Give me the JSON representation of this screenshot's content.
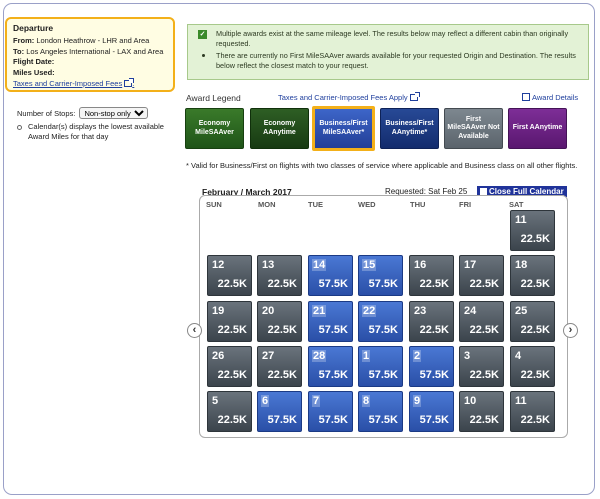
{
  "departure": {
    "title": "Departure",
    "from_label": "From:",
    "from_value": "London Heathrow - LHR and Area",
    "to_label": "To:",
    "to_value": "Los Angeles International - LAX and Area",
    "flight_date_label": "Flight Date:",
    "miles_used_label": "Miles Used:",
    "fees_link": "Taxes and Carrier-Imposed Fees"
  },
  "stops": {
    "label": "Number of Stops:",
    "selected": "Non-stop only",
    "note": "Calendar(s) displays the lowest available Award Miles for that day"
  },
  "info": {
    "line1": "Multiple awards exist at the same mileage level. The results below may reflect a different cabin than originally requested.",
    "line2": "There are currently no First MileSAAver awards available for your requested Origin and Destination. The results below reflect the closest match to your request."
  },
  "legend": {
    "title": "Award Legend",
    "fees_link": "Taxes and Carrier-Imposed Fees Apply",
    "award_details": "Award Details",
    "items": [
      "Economy MileSAAver",
      "Economy AAnytime",
      "Business/First MileSAAver*",
      "Business/First AAnytime*",
      "First MileSAAver Not Available",
      "First AAnytime"
    ]
  },
  "valid_note": "* Valid for Business/First on flights with two classes of service where applicable and Business class on all other flights.",
  "calendar": {
    "month": "February / March 2017",
    "requested": "Requested: Sat Feb 25",
    "close": "Close Full Calendar",
    "days": [
      "SUN",
      "MON",
      "TUE",
      "WED",
      "THU",
      "FRI",
      "SAT"
    ],
    "weeks": [
      [
        null,
        null,
        null,
        null,
        null,
        null,
        {
          "d": "11",
          "v": "22.5K",
          "t": "econ"
        }
      ],
      [
        {
          "d": "12",
          "v": "22.5K",
          "t": "econ"
        },
        {
          "d": "13",
          "v": "22.5K",
          "t": "econ"
        },
        {
          "d": "14",
          "v": "57.5K",
          "t": "bus"
        },
        {
          "d": "15",
          "v": "57.5K",
          "t": "bus"
        },
        {
          "d": "16",
          "v": "22.5K",
          "t": "econ"
        },
        {
          "d": "17",
          "v": "22.5K",
          "t": "econ"
        },
        {
          "d": "18",
          "v": "22.5K",
          "t": "econ"
        }
      ],
      [
        {
          "d": "19",
          "v": "22.5K",
          "t": "econ"
        },
        {
          "d": "20",
          "v": "22.5K",
          "t": "econ"
        },
        {
          "d": "21",
          "v": "57.5K",
          "t": "bus"
        },
        {
          "d": "22",
          "v": "57.5K",
          "t": "bus"
        },
        {
          "d": "23",
          "v": "22.5K",
          "t": "econ"
        },
        {
          "d": "24",
          "v": "22.5K",
          "t": "econ"
        },
        {
          "d": "25",
          "v": "22.5K",
          "t": "econ"
        }
      ],
      [
        {
          "d": "26",
          "v": "22.5K",
          "t": "econ"
        },
        {
          "d": "27",
          "v": "22.5K",
          "t": "econ"
        },
        {
          "d": "28",
          "v": "57.5K",
          "t": "bus"
        },
        {
          "d": "1",
          "v": "57.5K",
          "t": "bus"
        },
        {
          "d": "2",
          "v": "57.5K",
          "t": "bus"
        },
        {
          "d": "3",
          "v": "22.5K",
          "t": "econ"
        },
        {
          "d": "4",
          "v": "22.5K",
          "t": "econ"
        }
      ],
      [
        {
          "d": "5",
          "v": "22.5K",
          "t": "econ"
        },
        {
          "d": "6",
          "v": "57.5K",
          "t": "bus"
        },
        {
          "d": "7",
          "v": "57.5K",
          "t": "bus"
        },
        {
          "d": "8",
          "v": "57.5K",
          "t": "bus"
        },
        {
          "d": "9",
          "v": "57.5K",
          "t": "bus"
        },
        {
          "d": "10",
          "v": "22.5K",
          "t": "econ"
        },
        {
          "d": "11",
          "v": "22.5K",
          "t": "econ"
        }
      ]
    ]
  }
}
